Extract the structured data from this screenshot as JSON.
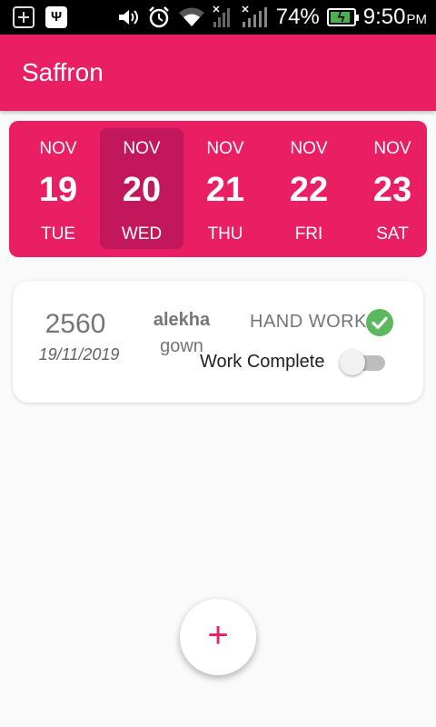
{
  "status_bar": {
    "battery_percent": "74%",
    "time": "9:50",
    "ampm": "PM",
    "icons": [
      "add-notification-icon",
      "usb-icon",
      "volume-icon",
      "alarm-icon",
      "wifi-icon",
      "signal-icon",
      "signal-icon",
      "battery-charging-icon"
    ]
  },
  "app_bar": {
    "title": "Saffron"
  },
  "date_strip": {
    "colors": {
      "background": "#e91e63",
      "selected": "#c2185b"
    },
    "days": [
      {
        "month": "NOV",
        "day": "19",
        "weekday": "TUE",
        "selected": false
      },
      {
        "month": "NOV",
        "day": "20",
        "weekday": "WED",
        "selected": true
      },
      {
        "month": "NOV",
        "day": "21",
        "weekday": "THU",
        "selected": false
      },
      {
        "month": "NOV",
        "day": "22",
        "weekday": "FRI",
        "selected": false
      },
      {
        "month": "NOV",
        "day": "23",
        "weekday": "SAT",
        "selected": false
      }
    ]
  },
  "order_card": {
    "order_number": "2560",
    "date": "19/11/2019",
    "customer": "alekha",
    "item": "gown",
    "work_type": "HAND WORK",
    "work_type_icon": "check-circle-icon",
    "complete_label": "Work Complete",
    "work_complete": false
  },
  "fab": {
    "icon": "plus-icon",
    "symbol": "+"
  }
}
